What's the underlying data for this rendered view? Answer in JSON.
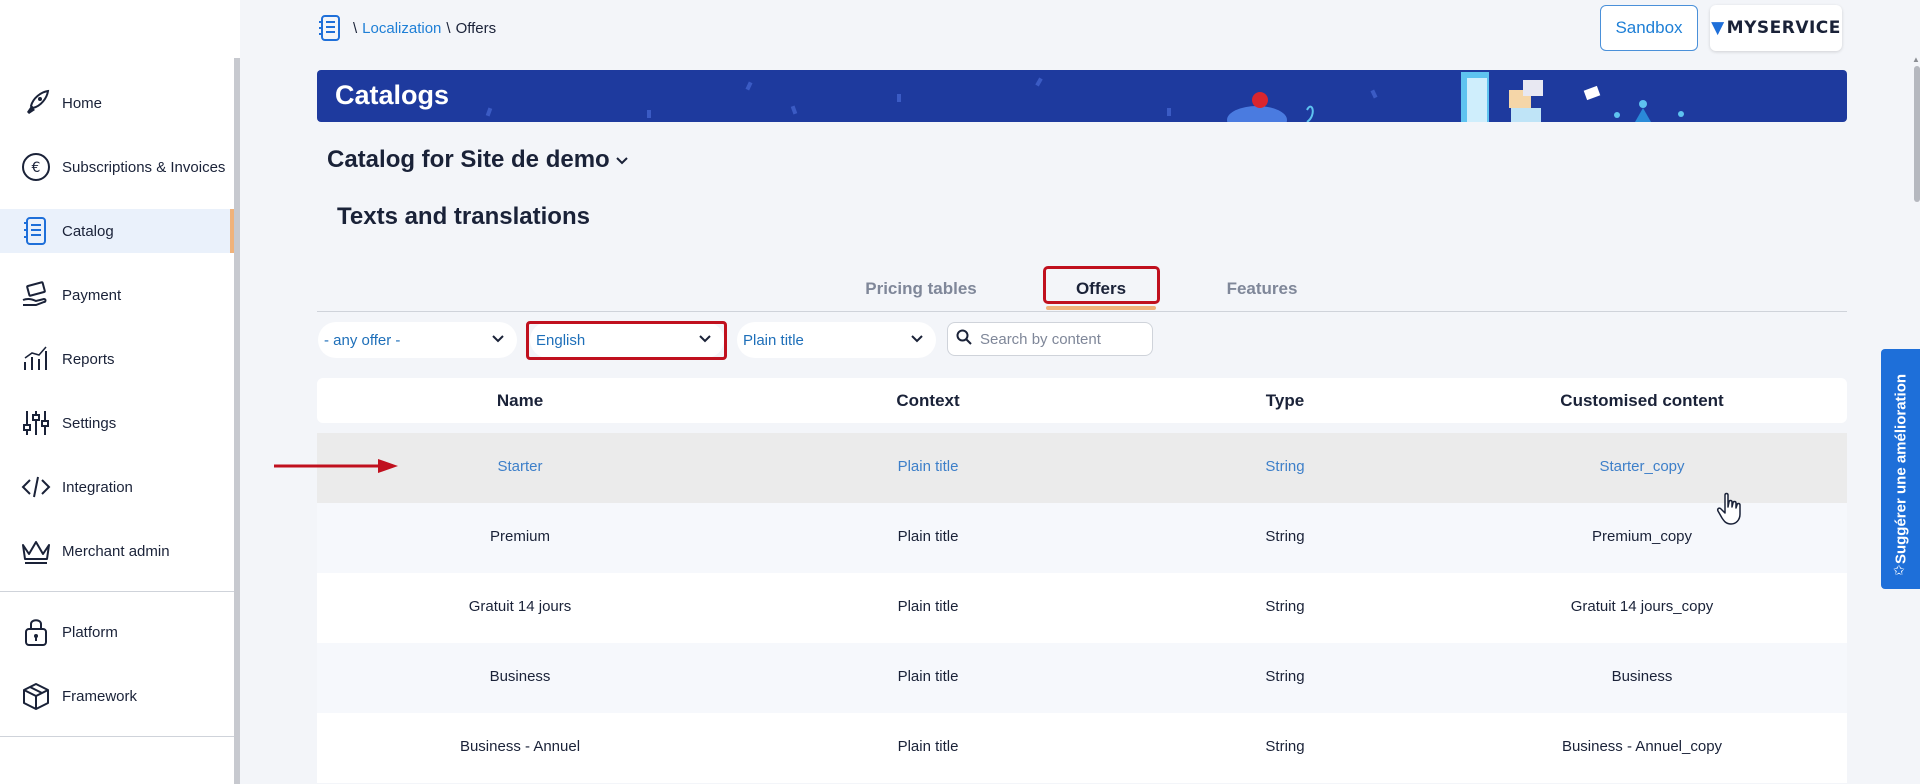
{
  "sidebar": {
    "items": [
      {
        "label": "Home",
        "icon": "rocket-icon"
      },
      {
        "label": "Subscriptions & Invoices",
        "icon": "euro-cycle-icon"
      },
      {
        "label": "Catalog",
        "icon": "notebook-icon",
        "active": true
      },
      {
        "label": "Payment",
        "icon": "hand-money-icon"
      },
      {
        "label": "Reports",
        "icon": "chart-icon"
      },
      {
        "label": "Settings",
        "icon": "sliders-icon"
      },
      {
        "label": "Integration",
        "icon": "code-icon"
      },
      {
        "label": "Merchant admin",
        "icon": "crown-icon"
      },
      {
        "label": "Platform",
        "icon": "lock-icon"
      },
      {
        "label": "Framework",
        "icon": "box-icon"
      }
    ]
  },
  "breadcrumb": {
    "link": "Localization",
    "current": "Offers",
    "sep": "\\"
  },
  "header": {
    "sandbox": "Sandbox",
    "logo": "MYSERVICE"
  },
  "banner": {
    "title": "Catalogs"
  },
  "catalog": {
    "name": "Catalog for Site de demo"
  },
  "section": {
    "title": "Texts and translations"
  },
  "tabs": [
    {
      "label": "Pricing tables"
    },
    {
      "label": "Offers",
      "active": true
    },
    {
      "label": "Features"
    }
  ],
  "filters": {
    "offer": "- any offer -",
    "language": "English",
    "context": "Plain title",
    "search_placeholder": "Search by content"
  },
  "table": {
    "columns": [
      "Name",
      "Context",
      "Type",
      "Customised content"
    ],
    "rows": [
      [
        "Starter",
        "Plain title",
        "String",
        "Starter_copy"
      ],
      [
        "Premium",
        "Plain title",
        "String",
        "Premium_copy"
      ],
      [
        "Gratuit 14 jours",
        "Plain title",
        "String",
        "Gratuit 14 jours_copy"
      ],
      [
        "Business",
        "Plain title",
        "String",
        "Business"
      ],
      [
        "Business - Annuel",
        "Plain title",
        "String",
        "Business - Annuel_copy"
      ]
    ]
  },
  "feedback": {
    "label": "Suggérer une amélioration"
  },
  "colors": {
    "accent": "#1e7fd6",
    "banner": "#1e3a9e",
    "highlight": "#c0101e",
    "tab_underline": "#f0b27a"
  }
}
